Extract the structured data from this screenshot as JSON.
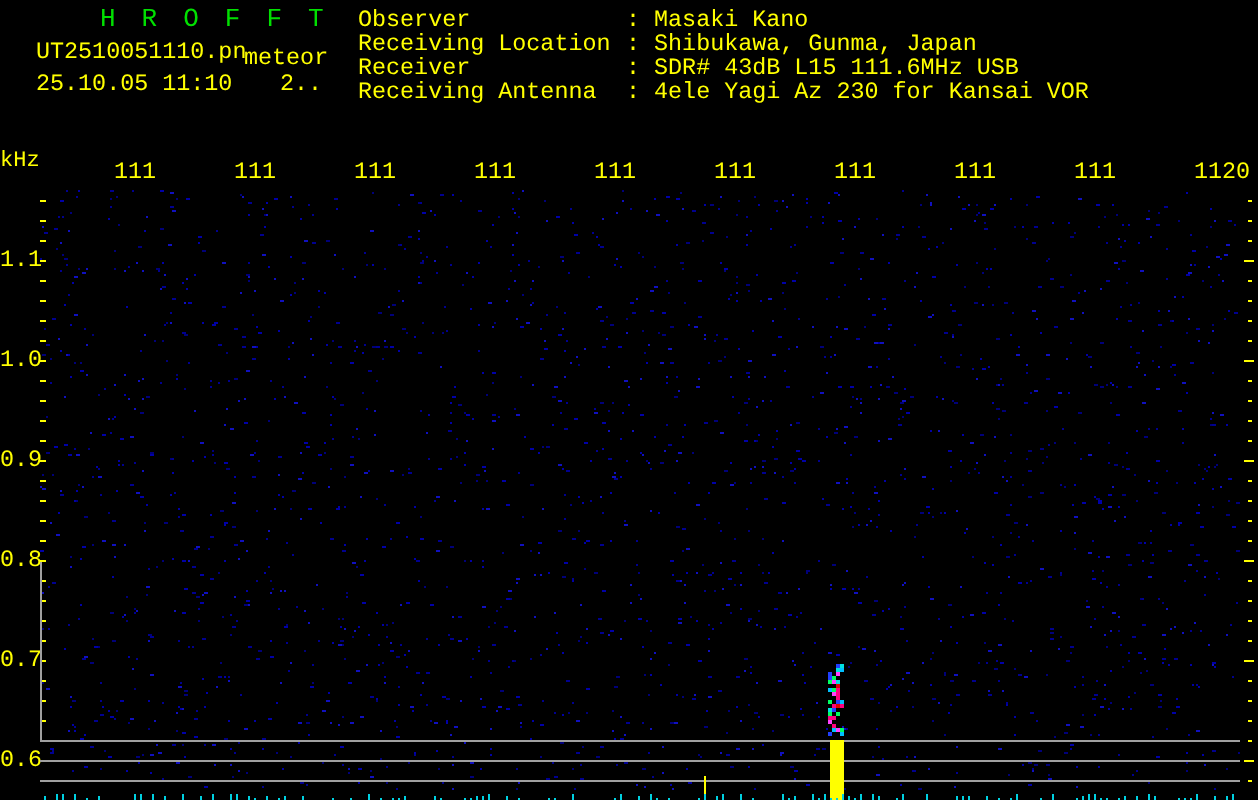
{
  "header": {
    "title": "H R O F F T",
    "file": "UT2510051110.pn",
    "mode": "meteor",
    "datetime": "25.10.05 11:10",
    "count": "2.."
  },
  "info": [
    {
      "label": "Observer",
      "value": ": Masaki Kano"
    },
    {
      "label": "Receiving Location",
      "value": ": Shibukawa, Gunma, Japan"
    },
    {
      "label": "Receiver",
      "value": ": SDR# 43dB L15 111.6MHz USB"
    },
    {
      "label": "Receiving Antenna",
      "value": ": 4ele Yagi Az 230 for Kansai VOR"
    }
  ],
  "x_axis": {
    "unit": "kHz",
    "ticks": [
      "111",
      "111",
      "111",
      "111",
      "111",
      "111",
      "111",
      "111",
      "111",
      "1120"
    ]
  },
  "y_axis": {
    "ticks": [
      "1.1",
      "1.0",
      "0.9",
      "0.8",
      "0.7",
      "0.6"
    ]
  }
}
